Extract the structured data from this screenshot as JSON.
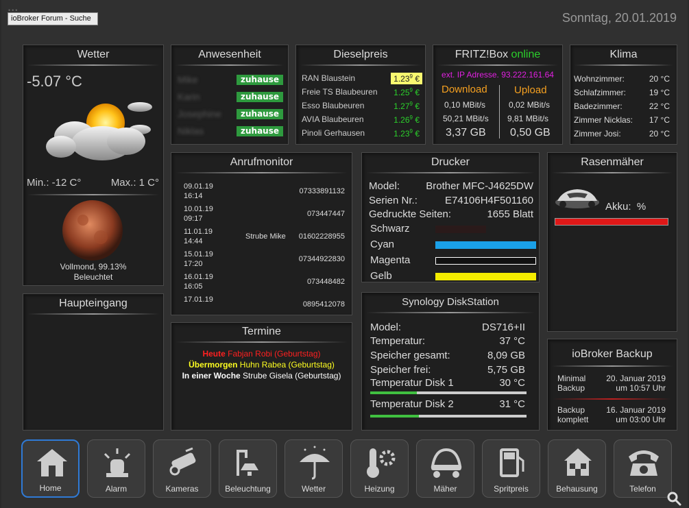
{
  "browser_tab": "ioBroker Forum - Suche",
  "date": "Sonntag, 20.01.2019",
  "wetter": {
    "title": "Wetter",
    "temp": "-5.07 °C",
    "min": "Min.: -12 C°",
    "max": "Max.: 1 C°",
    "moon_line1": "Vollmond, 99.13%",
    "moon_line2": "Beleuchtet"
  },
  "anwesenheit": {
    "title": "Anwesenheit",
    "people": [
      {
        "name": "Mike",
        "status": "zuhause"
      },
      {
        "name": "Karin",
        "status": "zuhause"
      },
      {
        "name": "Josephine",
        "status": "zuhause"
      },
      {
        "name": "Niklas",
        "status": "zuhause"
      }
    ]
  },
  "dieselpreis": {
    "title": "Dieselpreis",
    "stations": [
      {
        "name": "RAN Blaustein",
        "price": "1.23",
        "sup": "9",
        "unit": " €",
        "highlight": true
      },
      {
        "name": "Freie TS Blaubeuren",
        "price": "1.25",
        "sup": "9",
        "unit": " €",
        "highlight": false
      },
      {
        "name": "Esso Blaubeuren",
        "price": "1.27",
        "sup": "9",
        "unit": " €",
        "highlight": false
      },
      {
        "name": "AVIA Blaubeuren",
        "price": "1.26",
        "sup": "9",
        "unit": " €",
        "highlight": false
      },
      {
        "name": "Pinoli Gerhausen",
        "price": "1.23",
        "sup": "9",
        "unit": " €",
        "highlight": false
      }
    ]
  },
  "fritzbox": {
    "title": "FRITZ!Box",
    "status": "online",
    "ext_ip": "ext. IP Adresse. 93.222.161.64",
    "download_label": "Download",
    "upload_label": "Upload",
    "dl_rate": "0,10 MBit/s",
    "ul_rate": "0,02 MBit/s",
    "dl_max": "50,21 MBit/s",
    "ul_max": "9,81 MBit/s",
    "dl_total": "3,37 GB",
    "ul_total": "0,50 GB"
  },
  "klima": {
    "title": "Klima",
    "rooms": [
      {
        "name": "Wohnzimmer:",
        "value": "20 °C"
      },
      {
        "name": "Schlafzimmer:",
        "value": "19 °C"
      },
      {
        "name": "Badezimmer:",
        "value": "22 °C"
      },
      {
        "name": "Zimmer Nicklas:",
        "value": "17 °C"
      },
      {
        "name": "Zimmer Josi:",
        "value": "20 °C"
      }
    ]
  },
  "anrufmonitor": {
    "title": "Anrufmonitor",
    "calls": [
      {
        "date": "09.01.19",
        "time": "16:14",
        "name": "",
        "number": "07333891132"
      },
      {
        "date": "10.01.19",
        "time": "09:17",
        "name": "",
        "number": "073447447"
      },
      {
        "date": "11.01.19",
        "time": "14:44",
        "name": "Strube Mike",
        "number": "01602228955"
      },
      {
        "date": "15.01.19",
        "time": "17:20",
        "name": "",
        "number": "07344922830"
      },
      {
        "date": "16.01.19",
        "time": "16:05",
        "name": "",
        "number": "073448482"
      },
      {
        "date": "17.01.19",
        "time": "",
        "name": "",
        "number": "0895412078"
      }
    ]
  },
  "drucker": {
    "title": "Drucker",
    "model_label": "Model:",
    "model": "Brother MFC-J4625DW",
    "serial_label": "Serien Nr.:",
    "serial": "E74106H4F501160",
    "pages_label": "Gedruckte Seiten:",
    "pages": "1655 Blatt",
    "inks": [
      {
        "name": "Schwarz",
        "level": 0.0,
        "color": "#2a1a1a"
      },
      {
        "name": "Cyan",
        "level": 1.0,
        "color": "#1aa0e8"
      },
      {
        "name": "Magenta",
        "level": 0.0,
        "color": "#ffffff"
      },
      {
        "name": "Gelb",
        "level": 1.0,
        "color": "#f4ec00"
      }
    ]
  },
  "rasenmaeher": {
    "title": "Rasenmäher",
    "akku_label": "Akku:",
    "akku_unit": "%"
  },
  "haupteingang": {
    "title": "Haupteingang"
  },
  "synology": {
    "title": "Synology DiskStation",
    "rows": [
      {
        "label": "Model:",
        "value": "DS716+II"
      },
      {
        "label": "Temperatur:",
        "value": "37 °C"
      },
      {
        "label": "Speicher gesamt:",
        "value": "8,09 GB"
      },
      {
        "label": "Speicher frei:",
        "value": "5,75 GB"
      },
      {
        "label": "Temperatur Disk 1",
        "value": "30 °C"
      },
      {
        "label": "Temperatur Disk 2",
        "value": "31 °C"
      }
    ]
  },
  "termine": {
    "title": "Termine",
    "items": [
      {
        "when": "Heute",
        "what": " Fabjan Robi (Geburtstag)",
        "color": "#ff2020"
      },
      {
        "when": "Übermorgen",
        "what": " Huhn Rabea (Geburtstag)",
        "color": "#ffff20"
      },
      {
        "when": "In einer Woche",
        "what": " Strube Gisela (Geburtstag)",
        "color": "#ffffff"
      }
    ]
  },
  "backup": {
    "title": "ioBroker Backup",
    "minimal_label1": "Minimal",
    "minimal_label2": "Backup",
    "minimal_date": "20. Januar 2019",
    "minimal_time": "um 10:57 Uhr",
    "komplett_label1": "Backup",
    "komplett_label2": "komplett",
    "komplett_date": "16. Januar 2019",
    "komplett_time": "um 03:00 Uhr"
  },
  "nav": [
    {
      "label": "Home",
      "icon": "home-icon"
    },
    {
      "label": "Alarm",
      "icon": "alarm-icon"
    },
    {
      "label": "Kameras",
      "icon": "camera-icon"
    },
    {
      "label": "Beleuchtung",
      "icon": "lamp-icon"
    },
    {
      "label": "Wetter",
      "icon": "umbrella-icon"
    },
    {
      "label": "Heizung",
      "icon": "thermometer-icon"
    },
    {
      "label": "Mäher",
      "icon": "mower-icon"
    },
    {
      "label": "Spritpreis",
      "icon": "fuel-pump-icon"
    },
    {
      "label": "Behausung",
      "icon": "house-icon"
    },
    {
      "label": "Telefon",
      "icon": "phone-icon"
    }
  ]
}
